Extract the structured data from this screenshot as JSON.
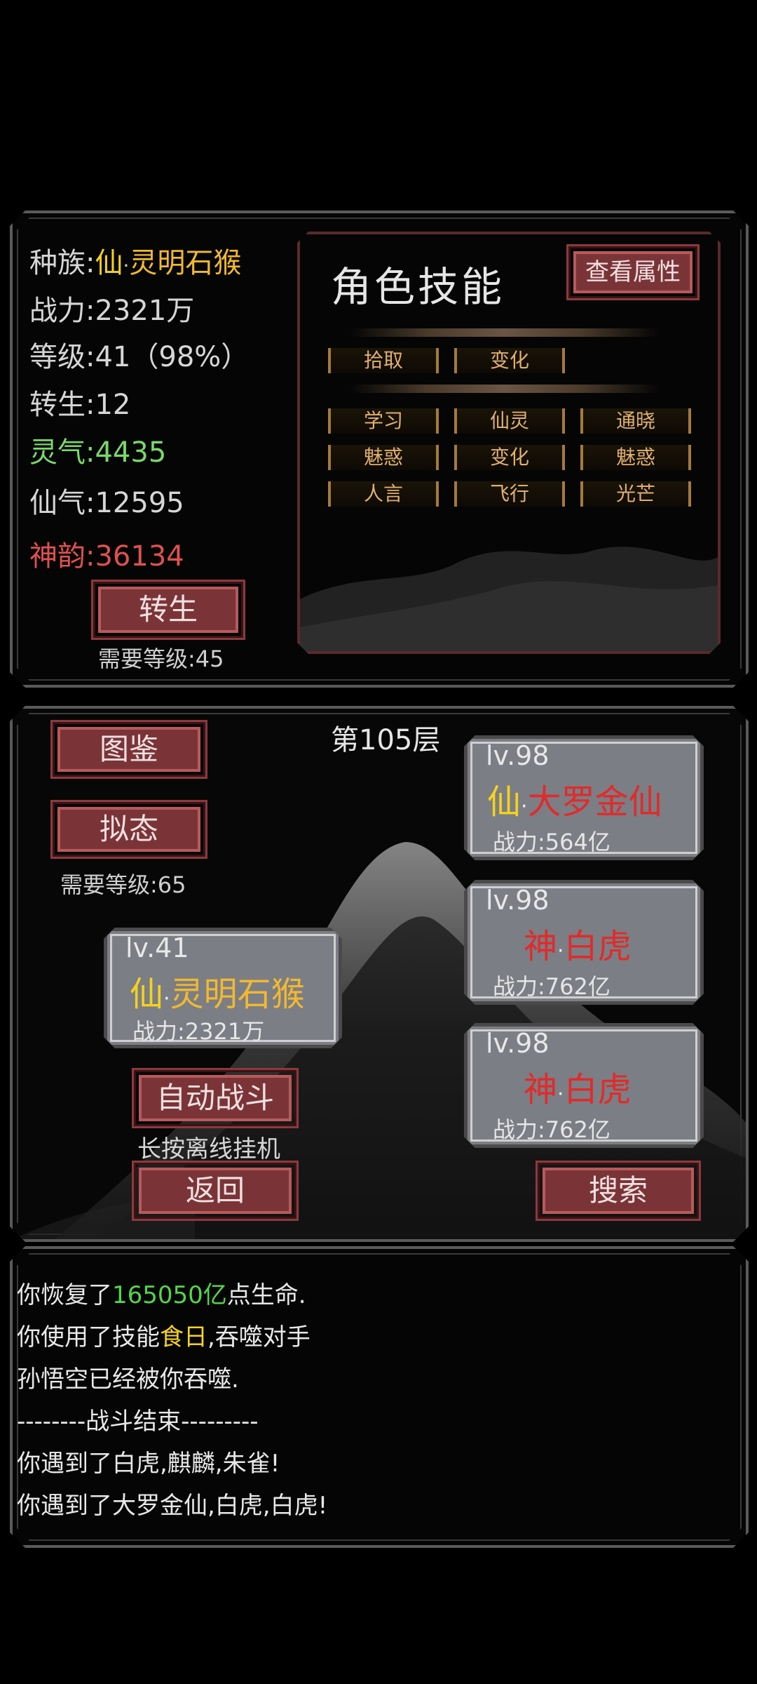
{
  "colors": {
    "gold": "#f2b830",
    "green": "#7ad86a",
    "red": "#e05050",
    "brightred": "#e22a2a",
    "yellow": "#f5d21e",
    "accent_btn": "#7a3438"
  },
  "stats": {
    "race_label": "种族:",
    "race_prefix": "仙",
    "race_dot": "·",
    "race_name": "灵明石猴",
    "power": "战力:2321万",
    "level": "等级:41（98%）",
    "rebirth": "转生:12",
    "lingqi": "灵气:4435",
    "xianqi": "仙气:12595",
    "shenyun": "神韵:36134"
  },
  "rebirth_button": "转生",
  "rebirth_req": "需要等级:45",
  "skills": {
    "title": "角色技能",
    "view_attr_button": "查看属性",
    "row1": [
      "拾取",
      "变化"
    ],
    "grid": [
      [
        "学习",
        "仙灵",
        "通晓"
      ],
      [
        "魅惑",
        "变化",
        "魅惑"
      ],
      [
        "人言",
        "飞行",
        "光芒"
      ]
    ]
  },
  "battle": {
    "floor": "第105层",
    "atlas_button": "图鉴",
    "mimic_button": "拟态",
    "mimic_req": "需要等级:65",
    "player": {
      "lv": "lv.41",
      "prefix": "仙",
      "dot": "·",
      "name": "灵明石猴",
      "power": "战力:2321万"
    },
    "enemies": [
      {
        "lv": "lv.98",
        "prefix": "仙",
        "dot": "·",
        "name": "大罗金仙",
        "power": "战力:564亿"
      },
      {
        "lv": "lv.98",
        "prefix": "神",
        "dot": "·",
        "name": "白虎",
        "power": "战力:762亿"
      },
      {
        "lv": "lv.98",
        "prefix": "神",
        "dot": "·",
        "name": "白虎",
        "power": "战力:762亿"
      }
    ],
    "auto_button": "自动战斗",
    "offline_hint": "长按离线挂机",
    "back_button": "返回",
    "search_button": "搜索"
  },
  "log": {
    "l1_a": "你恢复了",
    "l1_b": "165050亿",
    "l1_c": "点生命.",
    "l2_a": "你使用了技能",
    "l2_b": "食日",
    "l2_c": ",吞噬对手",
    "l3": "孙悟空已经被你吞噬.",
    "l4": "--------战斗结束---------",
    "l5": "你遇到了白虎,麒麟,朱雀!",
    "l6": "你遇到了大罗金仙,白虎,白虎!"
  }
}
